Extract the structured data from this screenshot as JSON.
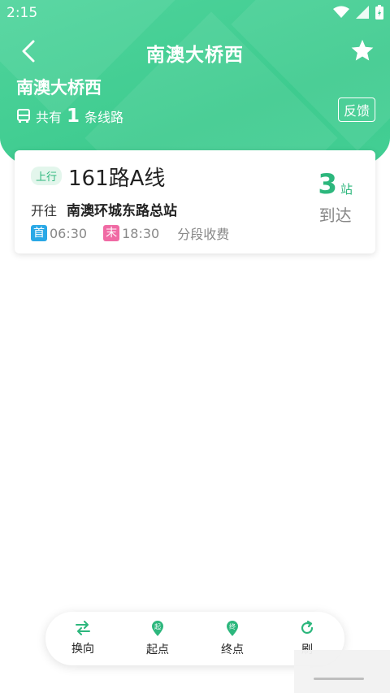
{
  "status_bar": {
    "time": "2:15"
  },
  "title_bar": {
    "title": "南澳大桥西"
  },
  "station": {
    "name": "南澳大桥西",
    "count_prefix": "共有",
    "count": "1",
    "count_suffix": "条线路",
    "feedback_label": "反馈"
  },
  "routes": [
    {
      "direction": "上行",
      "name": "161路A线",
      "toward_label": "开往",
      "destination": "南澳环城东路总站",
      "first_tag": "首",
      "first_time": "06:30",
      "last_tag": "末",
      "last_time": "18:30",
      "fare": "分段收费",
      "stops": "3",
      "stops_unit": "站",
      "arrive_label": "到达"
    }
  ],
  "bottom_nav": {
    "items": [
      {
        "label": "换向",
        "icon": "swap-icon"
      },
      {
        "label": "起点",
        "icon": "start-marker-icon",
        "glyph": "起"
      },
      {
        "label": "终点",
        "icon": "end-marker-icon",
        "glyph": "终"
      },
      {
        "label": "刷",
        "icon": "refresh-icon"
      }
    ]
  },
  "colors": {
    "accent": "#3ecb8f",
    "accent_text": "#2db77d",
    "first_tag": "#29a8e6",
    "last_tag": "#f06aa4"
  }
}
